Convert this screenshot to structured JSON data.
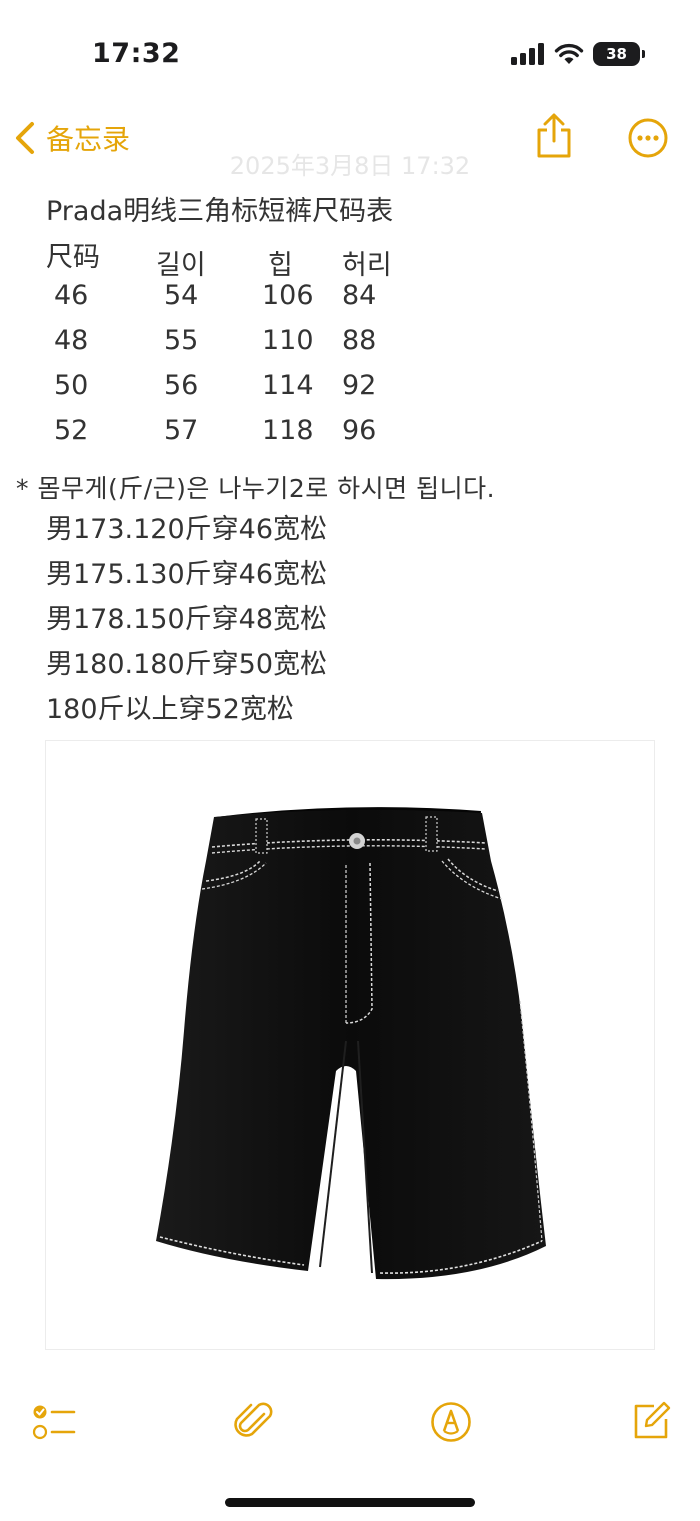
{
  "status_bar": {
    "time": "17:32",
    "battery_level": "38",
    "icons": [
      "cellular-signal-icon",
      "wifi-icon",
      "battery-icon"
    ]
  },
  "nav": {
    "back_label": "备忘录",
    "date": "2025年3月8日 17:32",
    "icons": [
      "chevron-left-icon",
      "share-icon",
      "more-icon"
    ]
  },
  "note": {
    "title": "Prada明线三角标短裤尺码表",
    "size_table": {
      "headers": [
        "尺码",
        "길이",
        "힙",
        "허리"
      ],
      "rows": [
        [
          "46",
          "54",
          "106",
          "84"
        ],
        [
          "48",
          "55",
          "110",
          "88"
        ],
        [
          "50",
          "56",
          "114",
          "92"
        ],
        [
          "52",
          "57",
          "118",
          "96"
        ]
      ]
    },
    "weight_note": "* 몸무게(斤/근)은 나누기2로 하시면 됩니다.",
    "recommendations": [
      "男173.120斤穿46宽松",
      "男175.130斤穿46宽松",
      "男178.150斤穿48宽松",
      "男180.180斤穿50宽松",
      "180斤以上穿52宽松"
    ]
  },
  "toolbar": {
    "icons": [
      "checklist-icon",
      "paperclip-icon",
      "markup-pen-icon",
      "compose-icon"
    ]
  },
  "colors": {
    "accent": "#e5a50a",
    "text": "#333333",
    "shorts": "#0d0d0d",
    "stitching": "#e8e8e8"
  }
}
